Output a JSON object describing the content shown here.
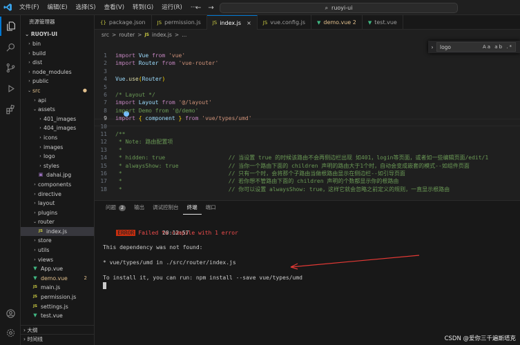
{
  "titlebar": {
    "menu": [
      "文件(F)",
      "编辑(E)",
      "选择(S)",
      "查看(V)",
      "转到(G)",
      "运行(R)",
      "···"
    ],
    "search": "ruoyi-ui"
  },
  "sidebar": {
    "title": "资源管理器",
    "root": "RUOYI-UI",
    "items": [
      {
        "label": "bin",
        "icon": "chevron-right",
        "depth": 0
      },
      {
        "label": "build",
        "icon": "chevron-right",
        "depth": 0
      },
      {
        "label": "dist",
        "icon": "chevron-right",
        "depth": 0
      },
      {
        "label": "node_modules",
        "icon": "chevron-right",
        "depth": 0
      },
      {
        "label": "public",
        "icon": "chevron-right",
        "depth": 0
      },
      {
        "label": "src",
        "icon": "chevron-down",
        "depth": 0,
        "modified": true
      },
      {
        "label": "api",
        "icon": "chevron-right",
        "depth": 1
      },
      {
        "label": "assets",
        "icon": "chevron-down",
        "depth": 1
      },
      {
        "label": "401_images",
        "icon": "chevron-right",
        "depth": 2
      },
      {
        "label": "404_images",
        "icon": "chevron-right",
        "depth": 2
      },
      {
        "label": "icons",
        "icon": "chevron-right",
        "depth": 2
      },
      {
        "label": "images",
        "icon": "chevron-right",
        "depth": 2
      },
      {
        "label": "logo",
        "icon": "chevron-right",
        "depth": 2
      },
      {
        "label": "styles",
        "icon": "chevron-right",
        "depth": 2
      },
      {
        "label": "dahai.jpg",
        "icon": "image-file",
        "depth": 2
      },
      {
        "label": "components",
        "icon": "chevron-right",
        "depth": 1
      },
      {
        "label": "directive",
        "icon": "chevron-right",
        "depth": 1
      },
      {
        "label": "layout",
        "icon": "chevron-right",
        "depth": 1
      },
      {
        "label": "plugins",
        "icon": "chevron-right",
        "depth": 1
      },
      {
        "label": "router",
        "icon": "chevron-down",
        "depth": 1
      },
      {
        "label": "index.js",
        "icon": "js-file",
        "depth": 2,
        "selected": true
      },
      {
        "label": "store",
        "icon": "chevron-right",
        "depth": 1
      },
      {
        "label": "utils",
        "icon": "chevron-right",
        "depth": 1
      },
      {
        "label": "views",
        "icon": "chevron-right",
        "depth": 1
      },
      {
        "label": "App.vue",
        "icon": "vue-file",
        "depth": 1
      },
      {
        "label": "demo.vue",
        "icon": "vue-file",
        "depth": 1,
        "modified": true,
        "badge": "2"
      },
      {
        "label": "main.js",
        "icon": "js-file",
        "depth": 1
      },
      {
        "label": "permission.js",
        "icon": "js-file",
        "depth": 1
      },
      {
        "label": "settings.js",
        "icon": "js-file",
        "depth": 1
      },
      {
        "label": "test.vue",
        "icon": "vue-file",
        "depth": 1
      }
    ],
    "outline": "大纲",
    "timeline": "时间线"
  },
  "tabs": [
    {
      "label": "package.json",
      "icon": "{}",
      "color": "#cbcb41"
    },
    {
      "label": "permission.js",
      "icon": "JS",
      "color": "#cbcb41"
    },
    {
      "label": "index.js",
      "icon": "JS",
      "color": "#cbcb41",
      "active": true
    },
    {
      "label": "vue.config.js",
      "icon": "JS",
      "color": "#cbcb41"
    },
    {
      "label": "demo.vue 2",
      "icon": "▼",
      "color": "#41b883",
      "modified": true
    },
    {
      "label": "test.vue",
      "icon": "▼",
      "color": "#41b883"
    }
  ],
  "breadcrumb": [
    "src",
    ">",
    "router",
    ">",
    "JS",
    "index.js",
    ">",
    "..."
  ],
  "find": {
    "value": "logo",
    "options": "Aa ab .*"
  },
  "editor": {
    "current_line": 9,
    "lines": [
      {
        "n": "1",
        "tokens": [
          [
            "k",
            "import "
          ],
          [
            "v",
            "Vue "
          ],
          [
            "k",
            "from "
          ],
          [
            "s",
            "'vue'"
          ]
        ]
      },
      {
        "n": "2",
        "tokens": [
          [
            "k",
            "import "
          ],
          [
            "v",
            "Router "
          ],
          [
            "k",
            "from "
          ],
          [
            "s",
            "'vue-router'"
          ]
        ]
      },
      {
        "n": "3",
        "tokens": []
      },
      {
        "n": "4",
        "tokens": [
          [
            "v",
            "Vue"
          ],
          [
            "p",
            "."
          ],
          [
            "f",
            "use"
          ],
          [
            "b",
            "("
          ],
          [
            "v",
            "Router"
          ],
          [
            "b",
            ")"
          ]
        ]
      },
      {
        "n": "5",
        "tokens": []
      },
      {
        "n": "6",
        "tokens": [
          [
            "c",
            "/* Layout */"
          ]
        ]
      },
      {
        "n": "7",
        "tokens": [
          [
            "k",
            "import "
          ],
          [
            "v",
            "Layout "
          ],
          [
            "k",
            "from "
          ],
          [
            "s",
            "'@/layout'"
          ]
        ]
      },
      {
        "n": "8",
        "tokens": [
          [
            "c",
            "import Demo from '@/demo'"
          ]
        ]
      },
      {
        "n": "9",
        "tokens": [
          [
            "k",
            "import "
          ],
          [
            "b",
            "{ "
          ],
          [
            "v",
            "component "
          ],
          [
            "b",
            "} "
          ],
          [
            "k",
            "from "
          ],
          [
            "s",
            "'vue/types/umd'"
          ]
        ]
      },
      {
        "n": "10",
        "tokens": []
      },
      {
        "n": "11",
        "tokens": [
          [
            "c",
            "/**"
          ]
        ]
      },
      {
        "n": "12",
        "tokens": [
          [
            "c",
            " * Note: 路由配置项"
          ]
        ]
      },
      {
        "n": "13",
        "tokens": [
          [
            "c",
            " *"
          ]
        ]
      },
      {
        "n": "14",
        "tokens": [
          [
            "c",
            " * hidden: true                   // 当设置 true 的时候该路由不会再侧边栏出现 如401，login等页面，或者如一些编辑页面/edit/1"
          ]
        ]
      },
      {
        "n": "15",
        "tokens": [
          [
            "c",
            " * alwaysShow: true               // 当你一个路由下面的 children 声明的路由大于1个时，自动会变成嵌套的模式--如组件页面"
          ]
        ]
      },
      {
        "n": "16",
        "tokens": [
          [
            "c",
            " *                                // 只有一个时，会将那个子路由当做根路由显示在侧边栏--如引导页面"
          ]
        ]
      },
      {
        "n": "17",
        "tokens": [
          [
            "c",
            " *                                // 若你想不管路由下面的 children 声明的个数都显示你的根路由"
          ]
        ]
      },
      {
        "n": "18",
        "tokens": [
          [
            "c",
            " *                                // 你可以设置 alwaysShow: true，这样它就会忽略之前定义的规则，一直显示根路由"
          ]
        ]
      }
    ]
  },
  "panel": {
    "tabs": [
      {
        "label": "问题",
        "count": "2"
      },
      {
        "label": "输出"
      },
      {
        "label": "调试控制台"
      },
      {
        "label": "终端",
        "active": true
      },
      {
        "label": "端口"
      }
    ],
    "error_badge": "ERROR",
    "error_text": "Failed to compile with 1 error",
    "time": "20:12:57",
    "line1": "This dependency was not found:",
    "line2": "* vue/types/umd in ./src/router/index.js",
    "line3": "To install it, you can run: npm install --save vue/types/umd"
  },
  "watermark": "CSDN @爱你三千遍斯塔克"
}
